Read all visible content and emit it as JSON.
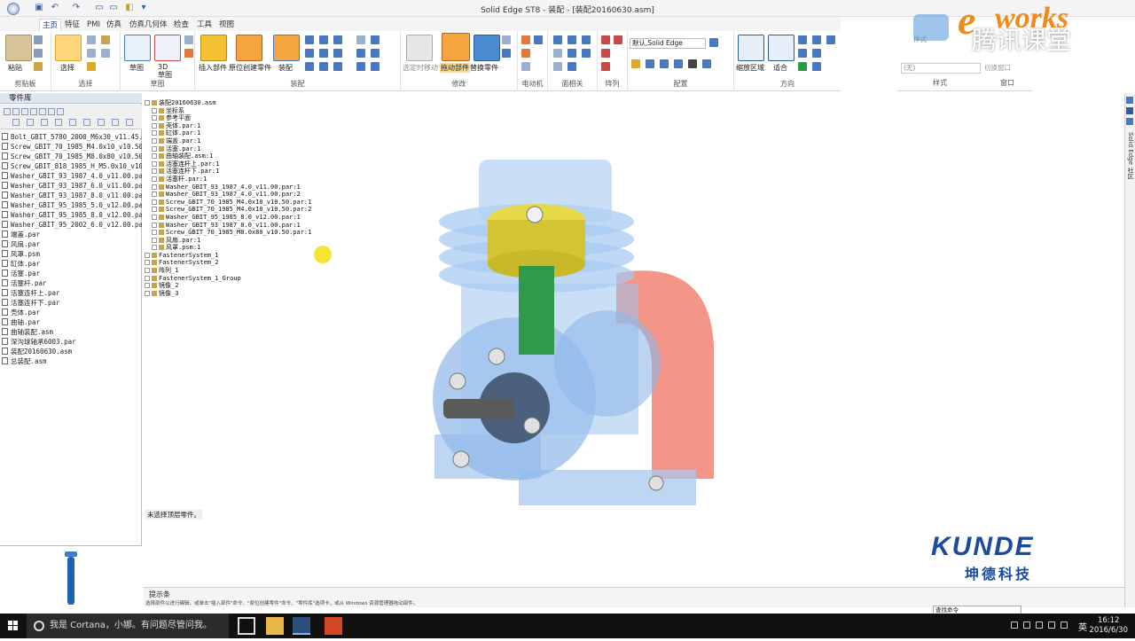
{
  "window": {
    "title": "Solid Edge ST8 - 装配 - [装配20160630.asm]"
  },
  "tabs": [
    "主页",
    "特征",
    "PMI",
    "仿真",
    "仿真几何体",
    "检查",
    "工具",
    "视图"
  ],
  "ribbon": {
    "groups": [
      "剪贴板",
      "选择",
      "草图",
      "装配",
      "修改",
      "电动机",
      "面相关",
      "阵列",
      "配置",
      "方向",
      "样式",
      "窗口"
    ],
    "paste": "粘贴",
    "select": "选择",
    "sketch": "草图",
    "sketch3d": "3D\n草图",
    "insert_part": "插入部件",
    "inplace_create": "原位创建零件",
    "assemble": "装配",
    "drag_move": "选定时移动",
    "drag_component": "拖动部件",
    "replace_part": "替换零件",
    "config_select": "默认,Solid Edge",
    "zoom_area": "缩放区域",
    "fit": "适合",
    "style_label": "样式",
    "style_value": "(无)",
    "switch_window": "切换窗口"
  },
  "sidebar": {
    "title": "零件库",
    "files": [
      "Bolt_GBIT_5780_2000_M6x30_v11.45.par",
      "Screw_GBIT_70_1985_M4.0x10_v10.50.par",
      "Screw_GBIT_70_1985_M8.0x80_v10.50.par",
      "Screw_GBIT_818_1985_H_M5.0x10_v10.50.",
      "Washer_GBIT_93_1987_4.0_v11.00.par",
      "Washer_GBIT_93_1987_6.0_v11.00.par",
      "Washer_GBIT_93_1987_8.0_v11.00.par",
      "Washer_GBIT_95_1985_5.0_v12.00.par",
      "Washer_GBIT_95_1985_8.0_v12.00.par",
      "Washer_GBIT_95_2002_6.0_v12.00.par",
      "端盖.par",
      "风扇.par",
      "风罩.psm",
      "缸体.par",
      "活塞.par",
      "活塞杆.par",
      "活塞连杆上.par",
      "活塞连杆下.par",
      "壳体.par",
      "曲轴.par",
      "曲轴装配.asm",
      "深沟球轴承6003.par",
      "装配20160630.asm",
      "总装配.asm"
    ]
  },
  "tree": {
    "items": [
      {
        "label": "装配20160630.asm",
        "indent": 0
      },
      {
        "label": "坐标系",
        "indent": 1
      },
      {
        "label": "参考平面",
        "indent": 1
      },
      {
        "label": "壳体.par:1",
        "indent": 1
      },
      {
        "label": "缸体.par:1",
        "indent": 1
      },
      {
        "label": "端盖.par:1",
        "indent": 1
      },
      {
        "label": "活塞.par:1",
        "indent": 1
      },
      {
        "label": "曲轴装配.asm:1",
        "indent": 1
      },
      {
        "label": "活塞连杆上.par:1",
        "indent": 1
      },
      {
        "label": "活塞连杆下.par:1",
        "indent": 1
      },
      {
        "label": "活塞杆.par:1",
        "indent": 1
      },
      {
        "label": "Washer_GBIT_93_1987_4.0_v11.00.par:1",
        "indent": 1
      },
      {
        "label": "Washer_GBIT_93_1987_4.0_v11.00.par:2",
        "indent": 1
      },
      {
        "label": "Screw_GBIT_70_1985_M4.0x10_v10.50.par:1",
        "indent": 1
      },
      {
        "label": "Screw_GBIT_70_1985_M4.0x10_v10.50.par:2",
        "indent": 1
      },
      {
        "label": "Washer_GBIT_95_1985_8.0_v12.00.par:1",
        "indent": 1
      },
      {
        "label": "Washer_GBIT_93_1987_8.0_v11.00.par:1",
        "indent": 1
      },
      {
        "label": "Screw_GBIT_70_1985_M8.0x80_v10.50.par:1",
        "indent": 1
      },
      {
        "label": "风扇.par:1",
        "indent": 1
      },
      {
        "label": "风罩.psm:1",
        "indent": 1
      },
      {
        "label": "FastenerSystem_1",
        "indent": 0
      },
      {
        "label": "FastenerSystem_2",
        "indent": 0
      },
      {
        "label": "阵列_1",
        "indent": 0
      },
      {
        "label": "FastenerSystem_1_Group",
        "indent": 0
      },
      {
        "label": "镜像_2",
        "indent": 0
      },
      {
        "label": "镜像_3",
        "indent": 0
      }
    ]
  },
  "canvas": {
    "status_message": "未选择顶层零件。",
    "watermark_cn": "腾讯课堂",
    "watermark_logo": "works",
    "brand": "KUNDE",
    "brand_cn": "坤德科技"
  },
  "right_panel": {
    "vertical_label": "Solid Edge 社区"
  },
  "hintbar": {
    "title": "提示条",
    "text": "选择部件以进行编辑，或单击\"插入部件\"命令、\"原位创建零件\"命令、\"零件库\"选项卡，或从 Windows 资源管理器拖动部件。",
    "find_cmd": "查找命令"
  },
  "taskbar": {
    "cortana": "我是 Cortana，小娜。有问题尽管问我。",
    "lang": "英",
    "time": "16:12",
    "date": "2016/6/30"
  }
}
